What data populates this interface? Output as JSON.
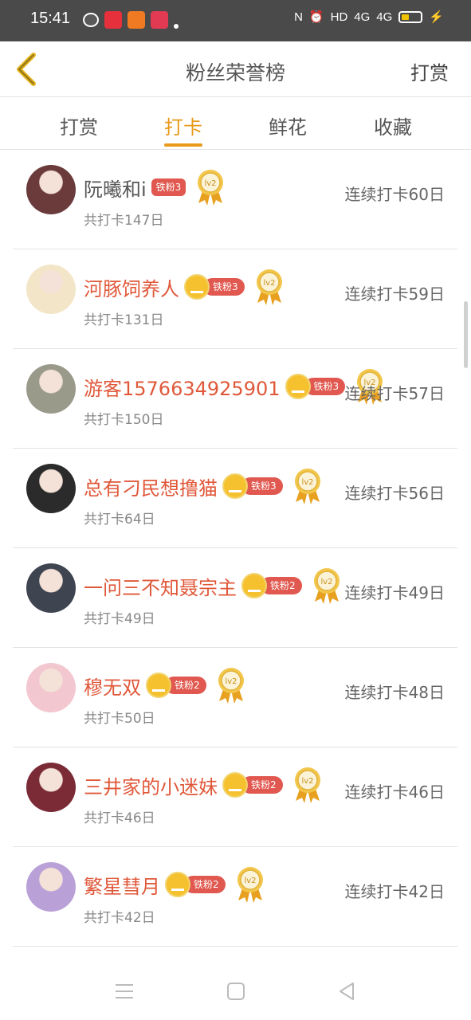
{
  "status_bar": {
    "time": "15:41",
    "right": [
      "HD",
      "4G",
      "4G"
    ]
  },
  "header": {
    "title": "粉丝荣誉榜",
    "right_action": "打赏"
  },
  "tabs": [
    {
      "label": "打赏",
      "active": false
    },
    {
      "label": "打卡",
      "active": true
    },
    {
      "label": "鲜花",
      "active": false
    },
    {
      "label": "收藏",
      "active": false
    }
  ],
  "medal_text": "lv2",
  "rows": [
    {
      "name": "阮曦和i",
      "fan": "铁粉3",
      "crown": false,
      "total": "共打卡147日",
      "streak": "连续打卡60日",
      "avatar_color": "#6b3b3b"
    },
    {
      "name": "河豚饲养人",
      "fan": "铁粉3",
      "crown": true,
      "total": "共打卡131日",
      "streak": "连续打卡59日",
      "avatar_color": "#f3e6c8"
    },
    {
      "name": "游客1576634925901",
      "fan": "铁粉3",
      "crown": true,
      "total": "共打卡150日",
      "streak": "连续打卡57日",
      "avatar_color": "#9a9a8a"
    },
    {
      "name": "总有刁民想撸猫",
      "fan": "铁粉3",
      "crown": true,
      "total": "共打卡64日",
      "streak": "连续打卡56日",
      "avatar_color": "#2b2b2b"
    },
    {
      "name": "一问三不知聂宗主",
      "fan": "铁粉2",
      "crown": true,
      "total": "共打卡49日",
      "streak": "连续打卡49日",
      "avatar_color": "#3e4450"
    },
    {
      "name": "穆无双",
      "fan": "铁粉2",
      "crown": true,
      "total": "共打卡50日",
      "streak": "连续打卡48日",
      "avatar_color": "#f2c7cf"
    },
    {
      "name": "三井家的小迷妹",
      "fan": "铁粉2",
      "crown": true,
      "total": "共打卡46日",
      "streak": "连续打卡46日",
      "avatar_color": "#7a2b36"
    },
    {
      "name": "繁星彗月",
      "fan": "铁粉2",
      "crown": true,
      "total": "共打卡42日",
      "streak": "连续打卡42日",
      "avatar_color": "#b9a0d6"
    }
  ]
}
